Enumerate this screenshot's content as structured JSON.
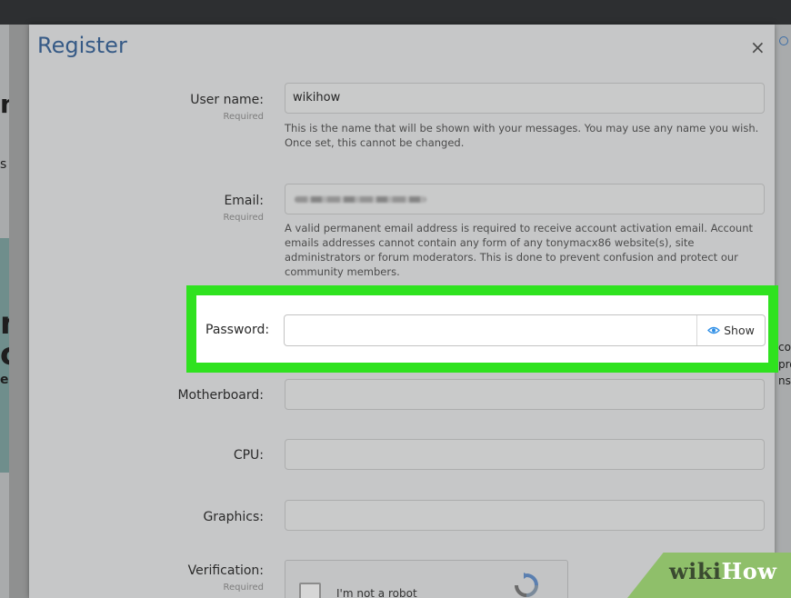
{
  "modal": {
    "title": "Register",
    "close_glyph": "×"
  },
  "form": {
    "username": {
      "label": "User name:",
      "required": "Required",
      "value": "wikihow",
      "help": "This is the name that will be shown with your messages. You may use any name you wish. Once set, this cannot be changed."
    },
    "email": {
      "label": "Email:",
      "required": "Required",
      "help": "A valid permanent email address is required to receive account activation email. Account emails addresses cannot contain any form of any tonymacx86 website(s), site administrators or forum moderators. This is done to prevent confusion and protect our community members."
    },
    "password": {
      "label": "Password:",
      "value": "",
      "show_label": "Show"
    },
    "motherboard": {
      "label": "Motherboard:",
      "value": ""
    },
    "cpu": {
      "label": "CPU:",
      "value": ""
    },
    "graphics": {
      "label": "Graphics:",
      "value": ""
    },
    "verification": {
      "label": "Verification:",
      "required": "Required",
      "captcha_text": "I'm not a robot"
    }
  },
  "background": {
    "left_fragments": [
      "m",
      "s",
      "n",
      "cy",
      "ea"
    ],
    "right_fragments": [
      "co",
      "pro",
      "nst"
    ]
  },
  "watermark": {
    "wiki": "wiki",
    "how": "How"
  },
  "colors": {
    "title": "#365a86",
    "highlight": "#2fe21f",
    "eye_icon": "#2e8ee6",
    "backdrop": "#8f9090"
  },
  "icons": {
    "close": "close-icon",
    "show_password": "eye-icon",
    "captcha": "recaptcha-logo-icon"
  }
}
